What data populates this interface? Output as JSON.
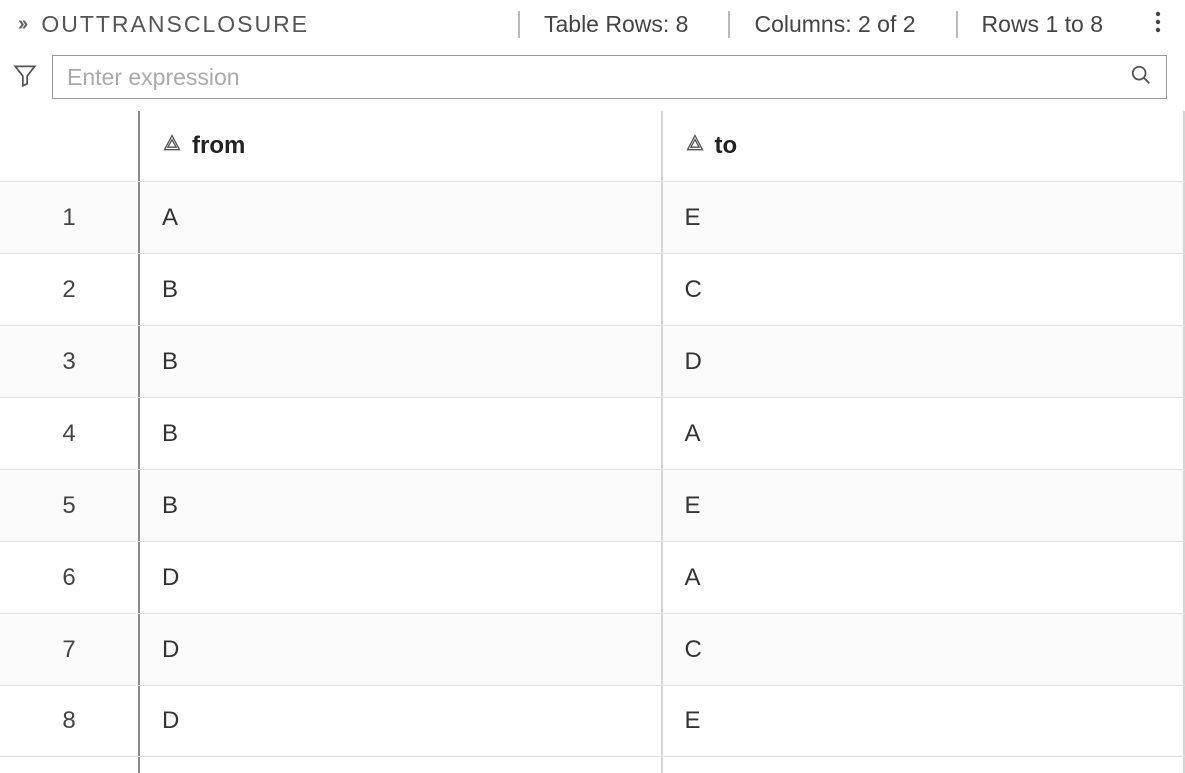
{
  "header": {
    "title": "OUTTRANSCLOSURE",
    "table_rows_label": "Table Rows: 8",
    "columns_label": "Columns: 2 of 2",
    "rows_range_label": "Rows 1 to 8"
  },
  "filter": {
    "placeholder": "Enter expression"
  },
  "table": {
    "columns": [
      {
        "name": "from"
      },
      {
        "name": "to"
      }
    ],
    "rows": [
      {
        "num": "1",
        "from": "A",
        "to": "E"
      },
      {
        "num": "2",
        "from": "B",
        "to": "C"
      },
      {
        "num": "3",
        "from": "B",
        "to": "D"
      },
      {
        "num": "4",
        "from": "B",
        "to": "A"
      },
      {
        "num": "5",
        "from": "B",
        "to": "E"
      },
      {
        "num": "6",
        "from": "D",
        "to": "A"
      },
      {
        "num": "7",
        "from": "D",
        "to": "C"
      },
      {
        "num": "8",
        "from": "D",
        "to": "E"
      }
    ]
  }
}
